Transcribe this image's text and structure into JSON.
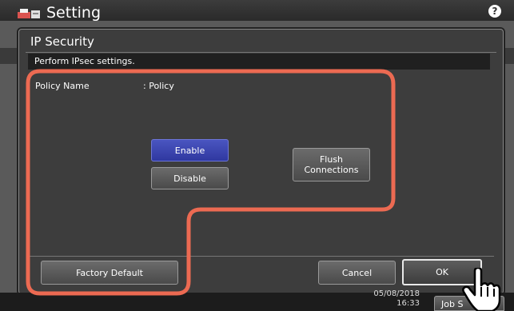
{
  "header": {
    "title": "Setting",
    "help_label": "?"
  },
  "dialog": {
    "title": "IP Security",
    "message": "Perform IPsec settings.",
    "policy_label": "Policy Name",
    "policy_value": ": Policy",
    "buttons": {
      "enable": "Enable",
      "disable": "Disable",
      "flush_line1": "Flush",
      "flush_line2": "Connections",
      "factory_default": "Factory Default",
      "cancel": "Cancel",
      "ok": "OK"
    },
    "selected": "Enable"
  },
  "status": {
    "date": "05/08/2018",
    "time": "16:33",
    "job_tab": "Job S"
  },
  "colors": {
    "highlight": "#ec6a52",
    "selected_button": "#3a44b0"
  },
  "icons": [
    "printer-icon",
    "help-icon",
    "hand-pointer-icon"
  ]
}
